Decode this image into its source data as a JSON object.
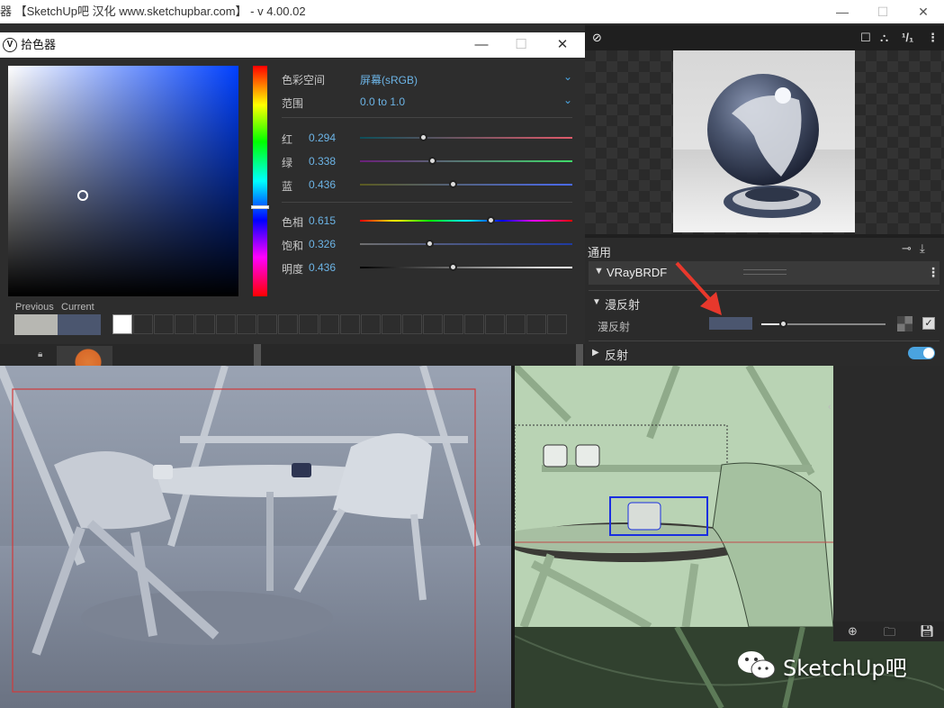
{
  "main_window": {
    "title": "器 【SketchUp吧 汉化 www.sketchupbar.com】 - v 4.00.02"
  },
  "color_picker": {
    "title": "拾色器",
    "color_space_label": "色彩空间",
    "color_space_value": "屏幕(sRGB)",
    "range_label": "范围",
    "range_value": "0.0 to 1.0",
    "rgb": [
      {
        "label": "红",
        "value": "0.294"
      },
      {
        "label": "绿",
        "value": "0.338"
      },
      {
        "label": "蓝",
        "value": "0.436"
      }
    ],
    "hsv": [
      {
        "label": "色相",
        "value": "0.615"
      },
      {
        "label": "饱和",
        "value": "0.326"
      },
      {
        "label": "明度",
        "value": "0.436"
      }
    ],
    "previous_label": "Previous",
    "current_label": "Current",
    "previous_color": "#b7b7b2",
    "current_color": "#4b566f"
  },
  "material_panel": {
    "general_label": "通用",
    "brdf_label": "VRayBRDF",
    "diffuse_section": "漫反射",
    "diffuse_param": "漫反射",
    "diffuse_color": "#4b566f",
    "reflection_section": "反射"
  },
  "watermark": {
    "text": "SketchUp吧"
  },
  "colors": {
    "accent": "#4aa3df",
    "arrow": "#e8382c"
  }
}
